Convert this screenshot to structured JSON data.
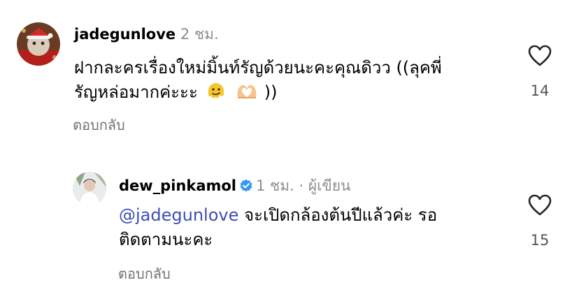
{
  "comments": [
    {
      "username": "jadegunlove",
      "time": "2 ชม.",
      "text_line1": "ฝากละครเรื่องใหม่มิ้นท์รัญด้วยนะคะคุณดิวว ((ลุคพี่",
      "text_line2": "รัญหล่อมากค่ะะะ",
      "text_line2_end": "))",
      "emojis": [
        "melting-face-emoji",
        "heart-hands-emoji"
      ],
      "reply_label": "ตอบกลับ",
      "likes": "14"
    },
    {
      "username": "dew_pinkamol",
      "verified": true,
      "time": "1 ชม.",
      "separator": "·",
      "author_label": "ผู้เขียน",
      "mention": "@jadegunlove",
      "text_line1": "จะเปิดกล้องต้นปีแล้วค่ะ รอ",
      "text_line2": "ติดตามนะคะ",
      "reply_label": "ตอบกลับ",
      "likes": "15"
    }
  ],
  "colors": {
    "verified_badge": "#3797f0",
    "mention": "#3b4fb5",
    "meta": "#8e8e8e"
  }
}
